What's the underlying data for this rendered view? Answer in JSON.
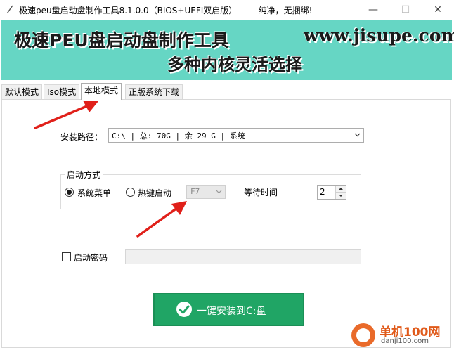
{
  "window": {
    "title": "极速peu盘启动盘制作工具8.1.0.0（BIOS+UEFI双启版）-------纯净，无捆绑!",
    "minimize": "—",
    "maximize": "☐",
    "close": "✕"
  },
  "banner": {
    "title": "极速PEU盘启动盘制作工具",
    "url": "www.jisupe.com",
    "subtitle": "多种内核灵活选择",
    "background": "#66d6c4"
  },
  "tabs": [
    {
      "label": "默认模式",
      "active": false
    },
    {
      "label": "Iso模式",
      "active": false
    },
    {
      "label": "本地模式",
      "active": true
    },
    {
      "label": "正版系统下载",
      "active": false
    }
  ],
  "install_path": {
    "label": "安装路径：",
    "value": "C:\\ | 总: 70G | 余 29 G | 系统"
  },
  "boot_mode": {
    "legend": "启动方式",
    "options": [
      {
        "label": "系统菜单",
        "checked": true
      },
      {
        "label": "热键启动",
        "checked": false
      }
    ],
    "hotkey": "F7",
    "wait_label": "等待时间",
    "wait_value": "2"
  },
  "password": {
    "label": "启动密码",
    "checked": false,
    "value": ""
  },
  "install_button": {
    "label": "一键安装到C:盘",
    "color": "#20a565"
  },
  "watermark": {
    "name": "单机100网",
    "url": "danji100.com"
  },
  "accent_colors": {
    "arrow": "#e0201a"
  }
}
